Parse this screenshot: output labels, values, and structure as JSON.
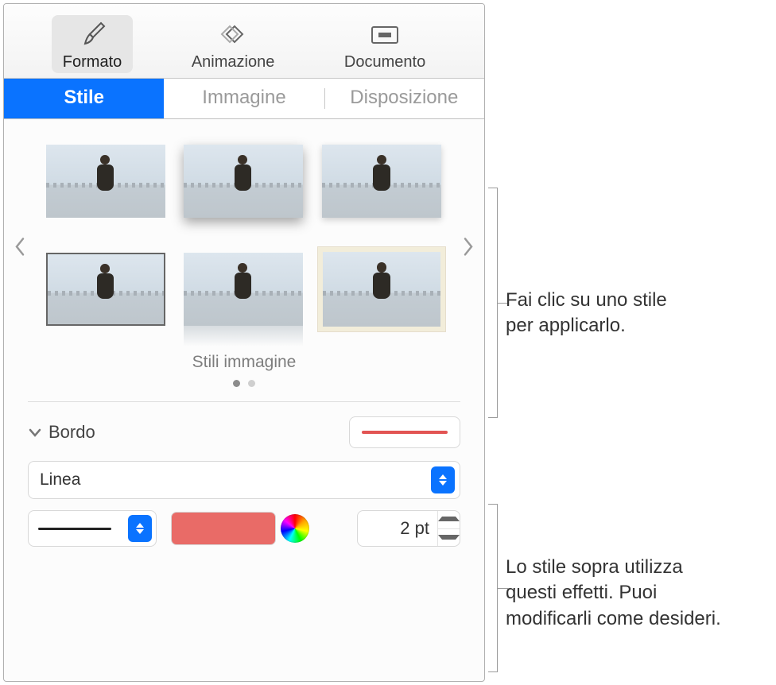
{
  "toolbar": {
    "format": "Formato",
    "animation": "Animazione",
    "document": "Documento"
  },
  "subtabs": {
    "style": "Stile",
    "image": "Immagine",
    "arrange": "Disposizione"
  },
  "styles_section_title": "Stili immagine",
  "border": {
    "title": "Bordo",
    "type": "Linea",
    "width": "2 pt"
  },
  "callouts": {
    "a_l1": "Fai clic su uno stile",
    "a_l2": "per applicarlo.",
    "b_l1": "Lo stile sopra utilizza",
    "b_l2": "questi effetti. Puoi",
    "b_l3": "modificarli come desideri."
  }
}
